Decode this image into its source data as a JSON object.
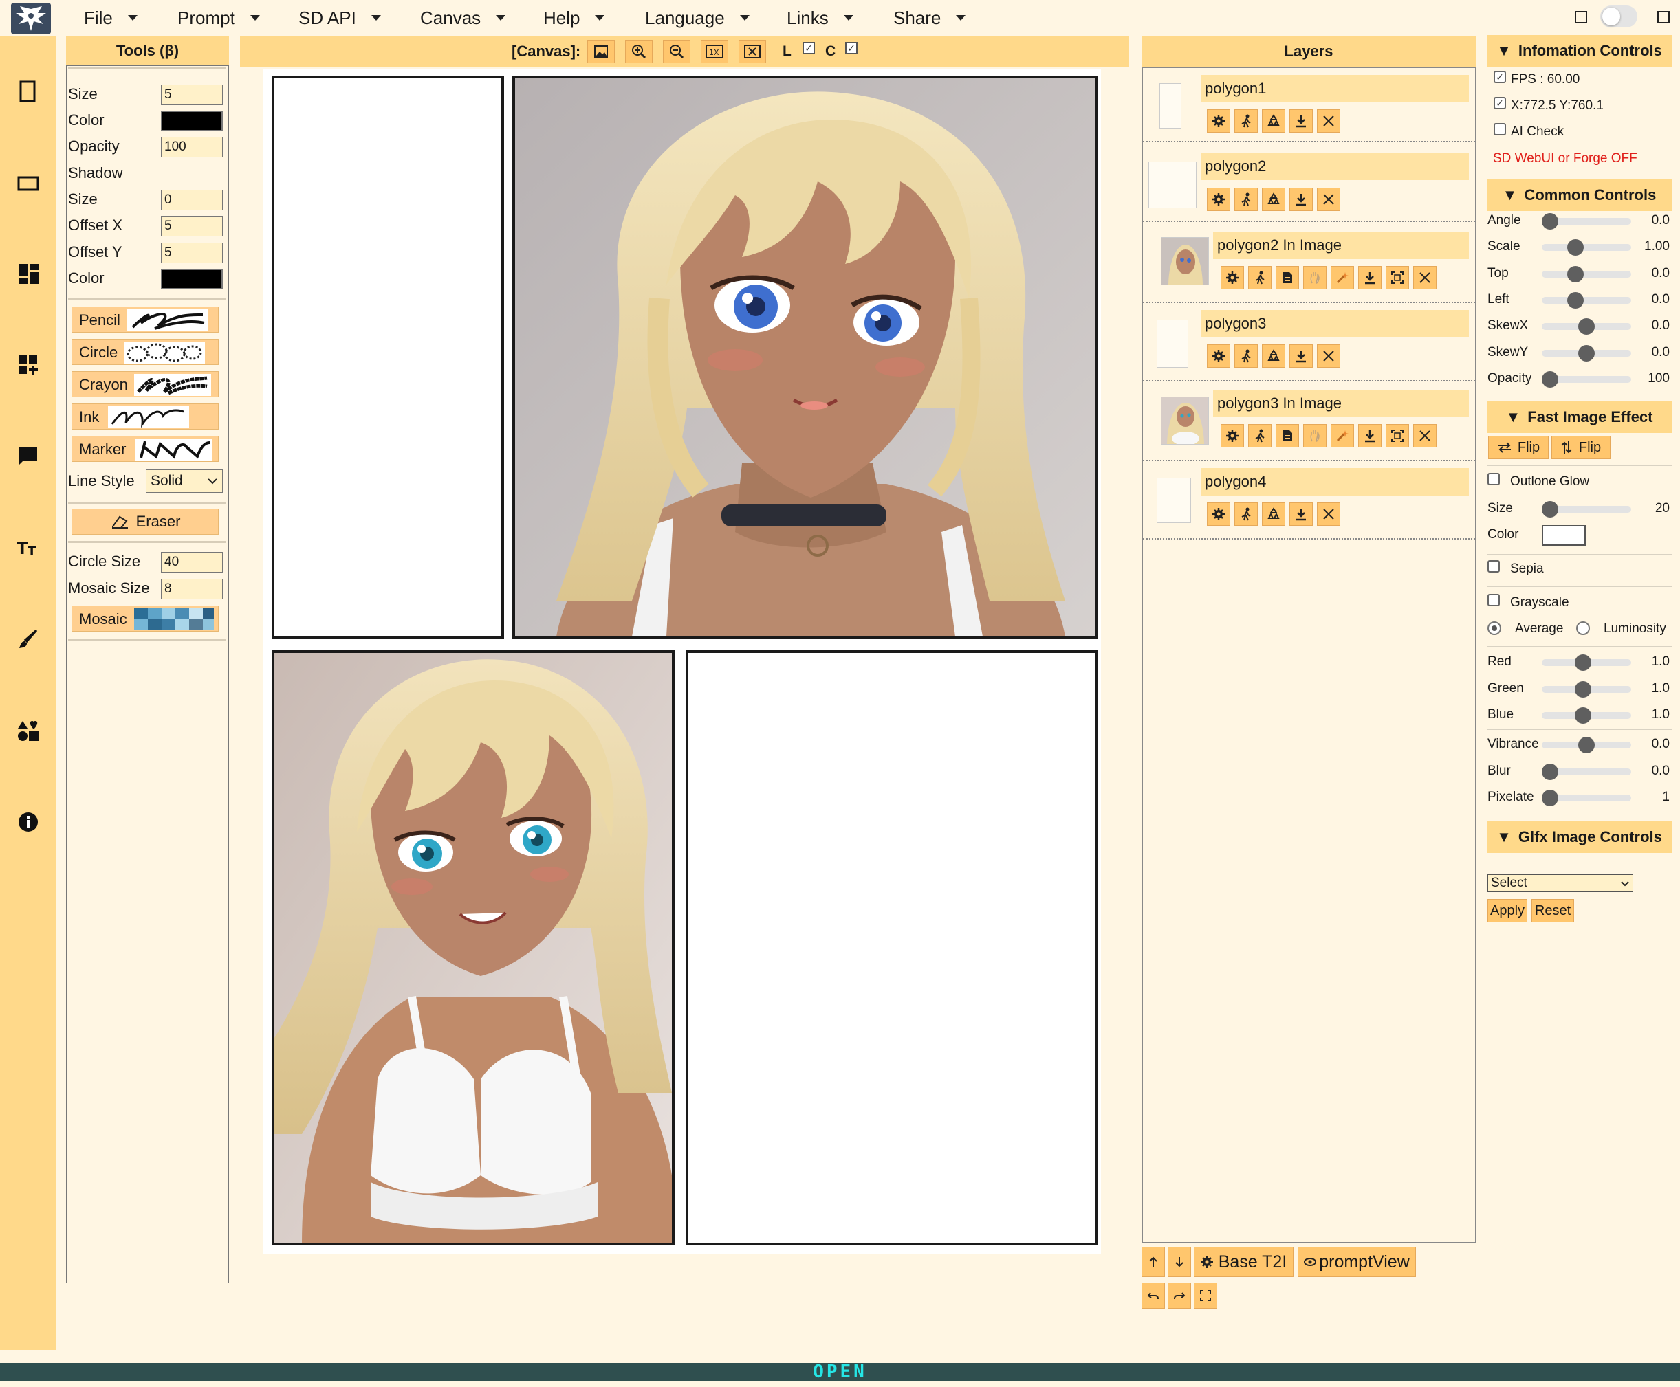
{
  "menu": {
    "items": [
      "File",
      "Prompt",
      "SD API",
      "Canvas",
      "Help",
      "Language",
      "Links",
      "Share"
    ]
  },
  "sidebar_icons": [
    "page-portrait-icon",
    "page-landscape-icon",
    "dashboard-icon",
    "add-panel-icon",
    "speech-bubble-icon",
    "text-icon",
    "brush-icon",
    "shapes-icon",
    "info-icon"
  ],
  "tools": {
    "title": "Tools (β)",
    "size_label": "Size",
    "size_value": "5",
    "color_label": "Color",
    "opacity_label": "Opacity",
    "opacity_value": "100",
    "shadow_label": "Shadow",
    "shadow_size_label": "Size",
    "shadow_size_value": "0",
    "offset_x_label": "Offset X",
    "offset_x_value": "5",
    "offset_y_label": "Offset Y",
    "offset_y_value": "5",
    "shadow_color_label": "Color",
    "brushes": [
      "Pencil",
      "Circle",
      "Crayon",
      "Ink",
      "Marker"
    ],
    "line_style_label": "Line Style",
    "line_style_value": "Solid",
    "eraser_label": "Eraser",
    "circle_size_label": "Circle Size",
    "circle_size_value": "40",
    "mosaic_size_label": "Mosaic Size",
    "mosaic_size_value": "8",
    "mosaic_label": "Mosaic"
  },
  "canvas_bar": {
    "label": "[Canvas]:",
    "l_label": "L",
    "c_label": "C"
  },
  "layers": {
    "title": "Layers",
    "items": [
      {
        "name": "polygon1"
      },
      {
        "name": "polygon2"
      },
      {
        "name": "polygon2 In Image"
      },
      {
        "name": "polygon3"
      },
      {
        "name": "polygon3 In Image"
      },
      {
        "name": "polygon4"
      }
    ],
    "base_t2i": "Base T2I",
    "prompt_view": "promptView"
  },
  "info_controls": {
    "title": "Infomation Controls",
    "fps": "FPS : 60.00",
    "coords": "X:772.5 Y:760.1",
    "ai_check": "AI Check",
    "status": "SD WebUI or Forge OFF",
    "status_color": "#e0201b"
  },
  "common_controls": {
    "title": "Common Controls",
    "sliders": [
      {
        "label": "Angle",
        "value": "0.0",
        "pos": 0.0
      },
      {
        "label": "Scale",
        "value": "1.00",
        "pos": 0.35
      },
      {
        "label": "Top",
        "value": "0.0",
        "pos": 0.35
      },
      {
        "label": "Left",
        "value": "0.0",
        "pos": 0.35
      },
      {
        "label": "SkewX",
        "value": "0.0",
        "pos": 0.5
      },
      {
        "label": "SkewY",
        "value": "0.0",
        "pos": 0.5
      },
      {
        "label": "Opacity",
        "value": "100",
        "pos": 0.0
      }
    ]
  },
  "fast_effect": {
    "title": "Fast Image Effect",
    "flip1": "Flip",
    "flip2": "Flip",
    "outline_glow": "Outlone Glow",
    "size_label": "Size",
    "size_value": "20",
    "color_label": "Color",
    "sepia": "Sepia",
    "grayscale": "Grayscale",
    "average": "Average",
    "luminosity": "Luminosity",
    "rgb": [
      {
        "label": "Red",
        "value": "1.0",
        "pos": 0.45
      },
      {
        "label": "Green",
        "value": "1.0",
        "pos": 0.45
      },
      {
        "label": "Blue",
        "value": "1.0",
        "pos": 0.45
      }
    ],
    "others": [
      {
        "label": "Vibrance",
        "value": "0.0",
        "pos": 0.5
      },
      {
        "label": "Blur",
        "value": "0.0",
        "pos": 0.0
      },
      {
        "label": "Pixelate",
        "value": "1",
        "pos": 0.0
      }
    ]
  },
  "glfx": {
    "title": "Glfx Image Controls",
    "select_value": "Select",
    "apply": "Apply",
    "reset": "Reset"
  },
  "footer": {
    "status": "OPEN"
  },
  "colors": {
    "accent": "#ffd98a",
    "button": "#ffc66d",
    "background": "#fff6e3",
    "footer": "#2f4f4f"
  }
}
